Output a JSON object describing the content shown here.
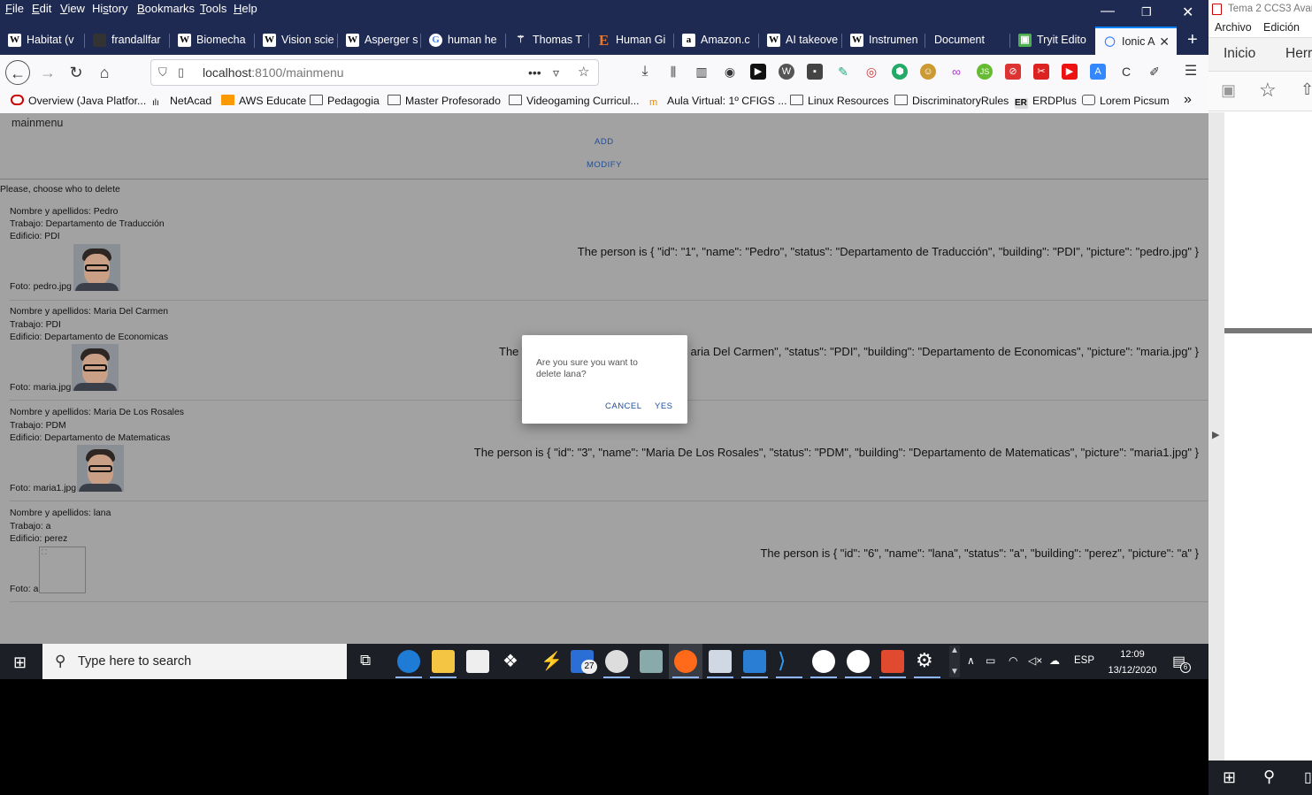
{
  "menubar": {
    "items": [
      "File",
      "Edit",
      "View",
      "History",
      "Bookmarks",
      "Tools",
      "Help"
    ],
    "underline": [
      "F",
      "E",
      "V",
      "s",
      "B",
      "T",
      "H"
    ]
  },
  "tabs": [
    {
      "label": "Habitat (v",
      "icon": "W"
    },
    {
      "label": "frandallfar",
      "icon": ""
    },
    {
      "label": "Biomecha",
      "icon": "W"
    },
    {
      "label": "Vision scie",
      "icon": "W"
    },
    {
      "label": "Asperger s",
      "icon": "W"
    },
    {
      "label": "human he",
      "icon": "G"
    },
    {
      "label": "Thomas T",
      "icon": "⚚"
    },
    {
      "label": "Human Gi",
      "icon": "E"
    },
    {
      "label": "Amazon.c",
      "icon": "a"
    },
    {
      "label": "AI takeove",
      "icon": "W"
    },
    {
      "label": "Instrumen",
      "icon": "W"
    },
    {
      "label": "Document",
      "icon": ""
    },
    {
      "label": "Tryit Edito",
      "icon": "▣"
    },
    {
      "label": "Ionic A",
      "icon": "◯"
    }
  ],
  "url": {
    "host": "localhost",
    "rest": ":8100/mainmenu"
  },
  "bookmarks": [
    "Overview (Java Platfor...",
    "NetAcad",
    "AWS Educate",
    "Pedagogia",
    "Master Profesorado",
    "Videogaming Curricul...",
    "Aula Virtual: 1º CFIGS ...",
    "Linux Resources",
    "DiscriminatoryRules",
    "ERDPlus",
    "Lorem Picsum"
  ],
  "page": {
    "title": "mainmenu",
    "add_label": "ADD",
    "modify_label": "MODIFY",
    "instruction": "Please, choose who to delete",
    "people": [
      {
        "name": "Nombre y apellidos: Pedro",
        "work": "Trabajo: Departamento de Traducción",
        "building": "Edificio: PDI",
        "photo": "Foto: pedro.jpg",
        "json": "The person is { \"id\": \"1\", \"name\": \"Pedro\", \"status\": \"Departamento de Traducción\", \"building\": \"PDI\", \"picture\": \"pedro.jpg\" }"
      },
      {
        "name": "Nombre y apellidos: Maria Del Carmen",
        "work": "Trabajo: PDI",
        "building": "Edificio: Departamento de Economicas",
        "photo": "Foto: maria.jpg",
        "json_left": "The",
        "json": "aria Del Carmen\", \"status\": \"PDI\", \"building\": \"Departamento de Economicas\", \"picture\": \"maria.jpg\" }"
      },
      {
        "name": "Nombre y apellidos: Maria De Los Rosales",
        "work": "Trabajo: PDM",
        "building": "Edificio: Departamento de Matematicas",
        "photo": "Foto: maria1.jpg",
        "json": "The person is { \"id\": \"3\", \"name\": \"Maria De Los Rosales\", \"status\": \"PDM\", \"building\": \"Departamento de Matematicas\", \"picture\": \"maria1.jpg\" }"
      },
      {
        "name": "Nombre y apellidos: lana",
        "work": "Trabajo: a",
        "building": "Edificio: perez",
        "photo": "Foto: a",
        "json": "The person is { \"id\": \"6\", \"name\": \"lana\", \"status\": \"a\", \"building\": \"perez\", \"picture\": \"a\" }"
      }
    ]
  },
  "dialog": {
    "message": "Are you sure you want to delete lana?",
    "cancel": "CANCEL",
    "yes": "YES"
  },
  "taskbar": {
    "search_placeholder": "Type here to search",
    "mail_badge": "27",
    "lang": "ESP",
    "time": "12:09",
    "date": "13/12/2020",
    "notif_count": "6"
  },
  "right_window": {
    "title": "Tema 2 CCS3 Avan",
    "menu": [
      "Archivo",
      "Edición"
    ],
    "tabs": [
      "Inicio",
      "Herr"
    ]
  },
  "colors": {
    "chrome_dark": "#1f2a52",
    "page_overlay": "#a2a2a2",
    "link_blue": "#1e4d9b",
    "taskbar": "#1d1f26"
  }
}
